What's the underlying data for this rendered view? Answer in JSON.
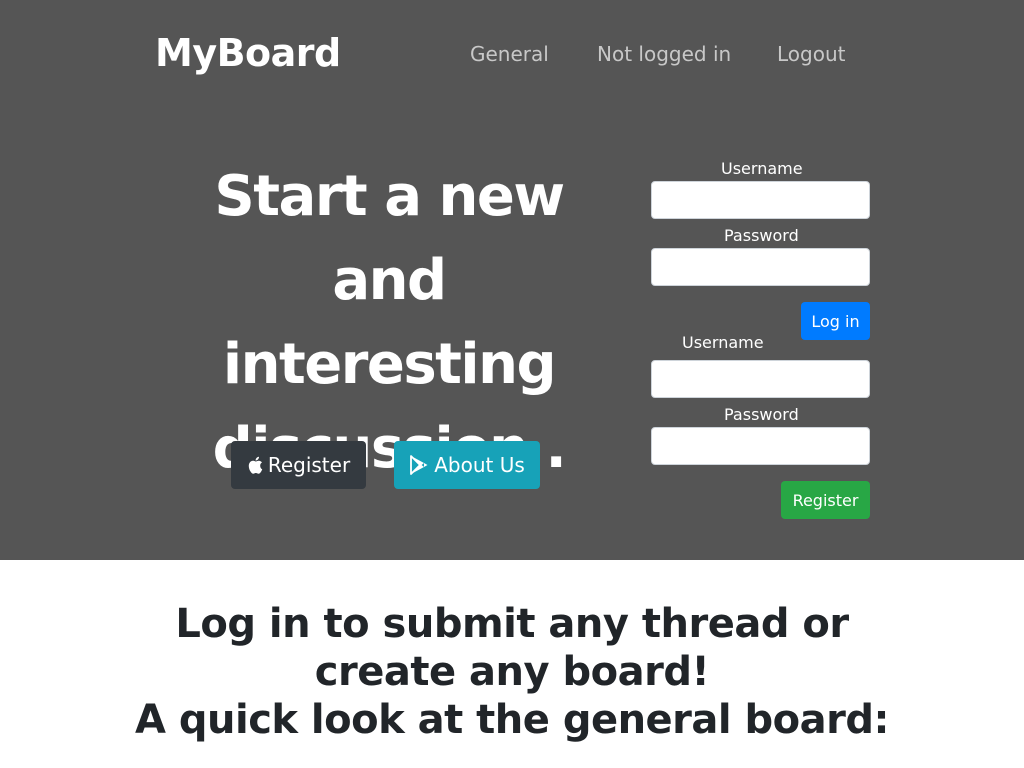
{
  "navbar": {
    "brand": "MyBoard",
    "links": [
      "General",
      "Not logged in",
      "Logout"
    ]
  },
  "hero": {
    "headline_lines": [
      "Start a new and",
      "interesting",
      "discussion ."
    ],
    "buttons": {
      "register": {
        "label": "Register",
        "icon": "apple-icon"
      },
      "about": {
        "label": "About Us",
        "icon": "play-store-icon"
      }
    }
  },
  "login_form": {
    "username_label": "Username",
    "username_value": "",
    "password_label": "Password",
    "password_value": "",
    "submit_label": "Log in"
  },
  "register_form": {
    "username_label": "Username",
    "username_value": "",
    "password_label": "Password",
    "password_value": "",
    "submit_label": "Register"
  },
  "lower": {
    "heading_lines": [
      "Log in to submit any thread or",
      "create any board!",
      "A quick look at the general board:"
    ]
  },
  "colors": {
    "hero_bg": "#555555",
    "primary": "#007bff",
    "success": "#28a745",
    "info": "#17a2b8",
    "dark": "#343a40"
  }
}
